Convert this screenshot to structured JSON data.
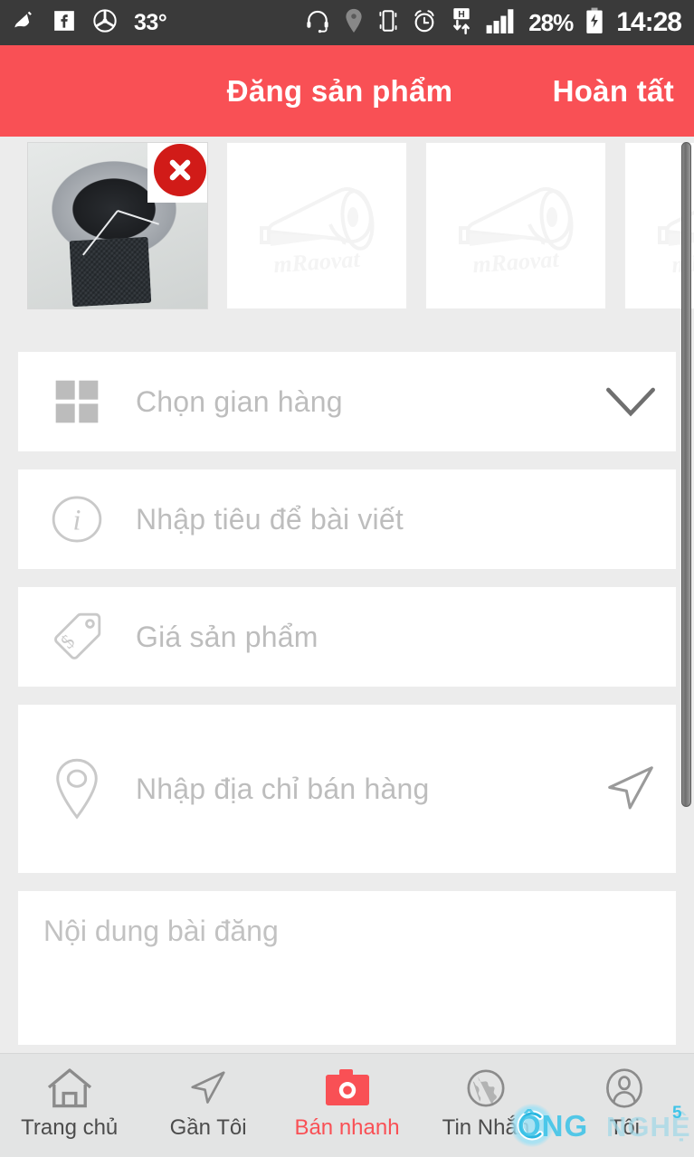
{
  "statusbar": {
    "temperature": "33°",
    "battery_percent": "28%",
    "clock": "14:28",
    "left_icons": [
      "broom-icon",
      "facebook-icon",
      "fan-icon"
    ],
    "right_icons": [
      "headset-icon",
      "location-icon",
      "vibrate-icon",
      "alarm-icon",
      "hspa-data-icon",
      "signal-bars-icon",
      "battery-charging-icon"
    ],
    "background": "#3a3a3a"
  },
  "header": {
    "title": "Đăng sản phẩm",
    "done_label": "Hoàn tất",
    "background": "#f95055"
  },
  "photos": {
    "items": [
      {
        "type": "photo",
        "alt": "watch-photo",
        "has_delete": true,
        "delete_icon": "close-x-icon"
      },
      {
        "type": "placeholder",
        "logo_text": "mRaovat",
        "logo_icon": "megaphone-icon"
      },
      {
        "type": "placeholder",
        "logo_text": "mRaovat",
        "logo_icon": "megaphone-icon"
      },
      {
        "type": "placeholder",
        "logo_text": "mRaovat",
        "logo_icon": "megaphone-icon"
      }
    ]
  },
  "form": {
    "shop": {
      "placeholder": "Chọn gian hàng",
      "icon": "grid-icon",
      "action_icon": "chevron-down-icon",
      "value": ""
    },
    "title": {
      "placeholder": "Nhập tiêu để bài viết",
      "icon": "info-icon",
      "value": ""
    },
    "price": {
      "placeholder": "Giá sản phẩm",
      "icon": "price-tag-icon",
      "value": ""
    },
    "address": {
      "placeholder": "Nhập địa chỉ bán hàng",
      "icon": "map-pin-icon",
      "action_icon": "navigation-arrow-icon",
      "value": ""
    },
    "body": {
      "placeholder": "Nội dung bài đăng",
      "value": ""
    }
  },
  "bottomnav": {
    "active_index": 2,
    "active_color": "#f95055",
    "items": [
      {
        "label": "Trang chủ",
        "icon": "home-icon"
      },
      {
        "label": "Gần Tôi",
        "icon": "navigation-arrow-icon"
      },
      {
        "label": "Bán nhanh",
        "icon": "camera-icon"
      },
      {
        "label": "Tin Nhắn",
        "icon": "globe-icon"
      },
      {
        "label": "Tôi",
        "icon": "person-circle-icon"
      }
    ]
  },
  "watermark": {
    "text_primary": "ÔNG",
    "text_secondary": "NGHỆ",
    "superscript": "5",
    "color": "#3fc4e8"
  }
}
